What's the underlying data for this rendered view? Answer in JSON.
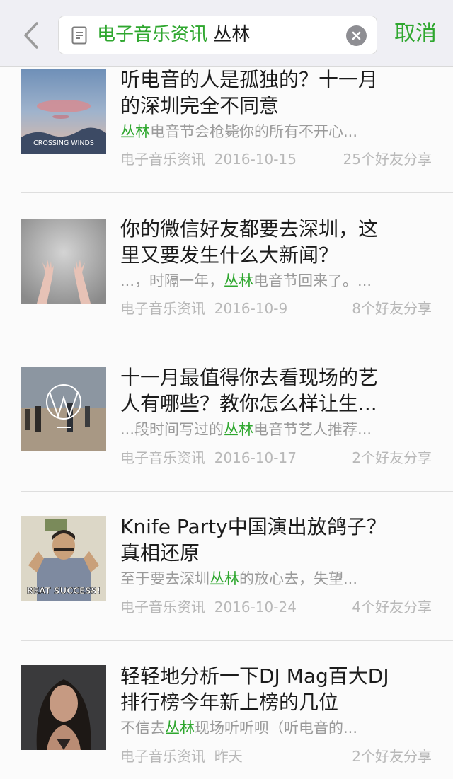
{
  "header": {
    "search_keyword": "电子音乐资讯",
    "search_query": "丛林",
    "cancel_label": "取消"
  },
  "results": [
    {
      "title_line1": "听电音的人是孤独的？十一月",
      "title_line2": "的深圳完全不同意",
      "snippet_pre": "",
      "snippet_hl": "丛林",
      "snippet_post": "电音节会枪毙你的所有不开心...",
      "source": "电子音乐资讯",
      "date": "2016-10-15",
      "shares": "25个好友分享",
      "thumb_caption": "CROSSING WINDS"
    },
    {
      "title_line1": "你的微信好友都要去深圳，这",
      "title_line2": "里又要发生什么大新闻？",
      "snippet_pre": "...，时隔一年，",
      "snippet_hl": "丛林",
      "snippet_post": "电音节回来了。...",
      "source": "电子音乐资讯",
      "date": "2016-10-9",
      "shares": "8个好友分享"
    },
    {
      "title_line1": "十一月最值得你去看现场的艺",
      "title_line2": "人有哪些？教你怎么样让生...",
      "snippet_pre": "...段时间写过的",
      "snippet_hl": "丛林",
      "snippet_post": "电音节艺人推荐...",
      "source": "电子音乐资讯",
      "date": "2016-10-17",
      "shares": "2个好友分享"
    },
    {
      "title_line1": "Knife Party中国演出放鸽子？",
      "title_line2": "真相还原",
      "snippet_pre": "至于要去深圳",
      "snippet_hl": "丛林",
      "snippet_post": "的放心去，失望...",
      "source": "电子音乐资讯",
      "date": "2016-10-24",
      "shares": "4个好友分享",
      "thumb_caption": "REAT SUCCESS!"
    },
    {
      "title_line1": "轻轻地分析一下DJ Mag百大DJ",
      "title_line2": "排行榜今年新上榜的几位",
      "snippet_pre": "不信去",
      "snippet_hl": "丛林",
      "snippet_post": "现场听听呗（听电音的...",
      "source": "电子音乐资讯",
      "date": "昨天",
      "shares": "2个好友分享"
    }
  ],
  "colors": {
    "accent": "#2fa72f",
    "header_bg": "#efeff4",
    "meta_text": "#b8b8b8"
  }
}
